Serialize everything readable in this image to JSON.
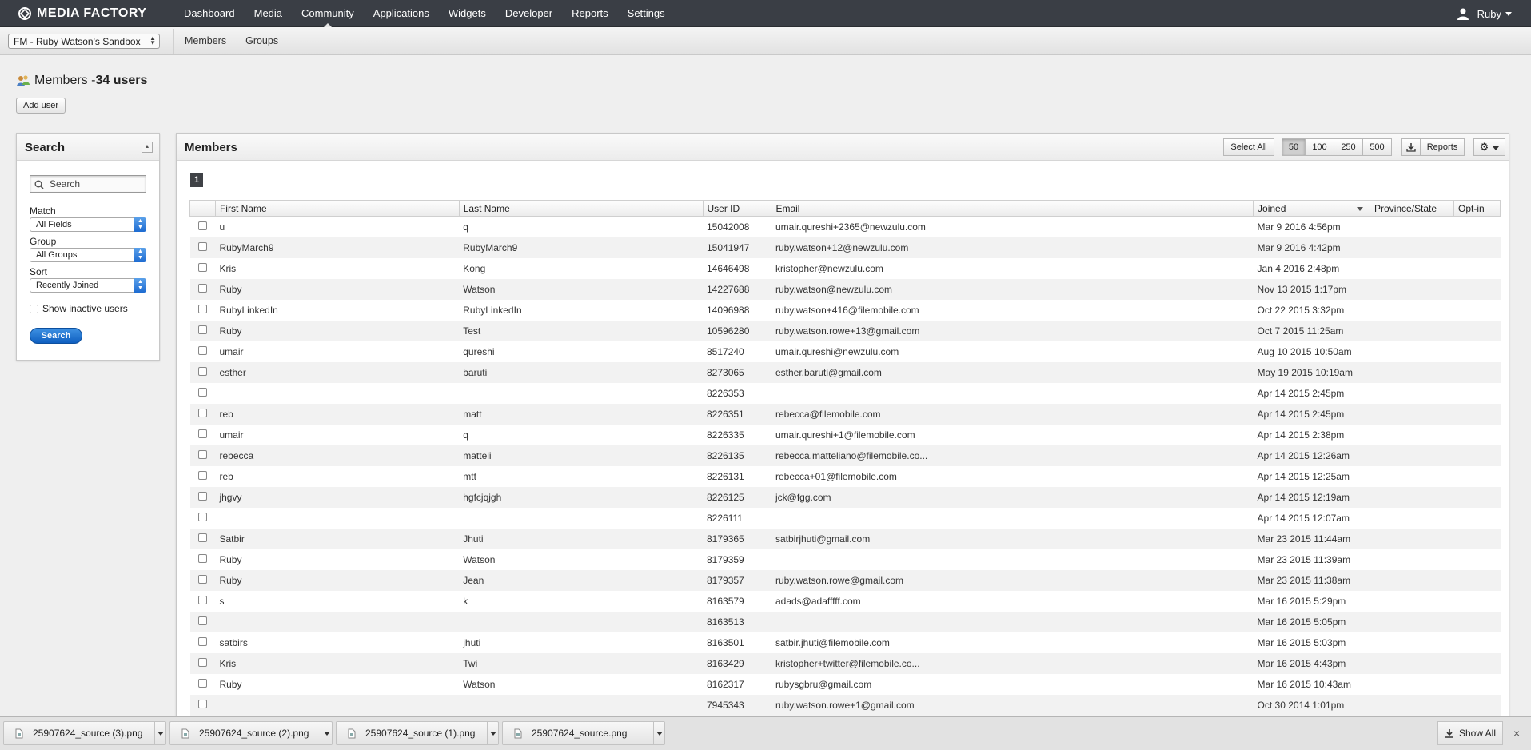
{
  "app": {
    "brand": "MEDIA FACTORY",
    "nav": [
      "Dashboard",
      "Media",
      "Community",
      "Applications",
      "Widgets",
      "Developer",
      "Reports",
      "Settings"
    ],
    "active_nav": "Community",
    "user": "Ruby"
  },
  "subnav": {
    "site": "FM - Ruby Watson's Sandbox",
    "items": [
      "Members",
      "Groups"
    ]
  },
  "header": {
    "title": "Members - ",
    "count": "34 users",
    "add_user": "Add user"
  },
  "search": {
    "title": "Search",
    "placeholder": "Search",
    "match_label": "Match",
    "match_value": "All Fields",
    "group_label": "Group",
    "group_value": "All Groups",
    "sort_label": "Sort",
    "sort_value": "Recently Joined",
    "inactive_label": "Show inactive users",
    "button": "Search"
  },
  "members": {
    "title": "Members",
    "select_all": "Select All",
    "page_sizes": [
      "50",
      "100",
      "250",
      "500"
    ],
    "active_page_size": "50",
    "reports": "Reports",
    "page": "1",
    "columns": [
      "First Name",
      "Last Name",
      "User ID",
      "Email",
      "Joined",
      "Province/State",
      "Opt-in"
    ],
    "sorted_column": "Joined",
    "rows": [
      [
        "u",
        "q",
        "15042008",
        "umair.qureshi+2365@newzulu.com",
        "Mar 9 2016 4:56pm"
      ],
      [
        "RubyMarch9",
        "RubyMarch9",
        "15041947",
        "ruby.watson+12@newzulu.com",
        "Mar 9 2016 4:42pm"
      ],
      [
        "Kris",
        "Kong",
        "14646498",
        "kristopher@newzulu.com",
        "Jan 4 2016 2:48pm"
      ],
      [
        "Ruby",
        "Watson",
        "14227688",
        "ruby.watson@newzulu.com",
        "Nov 13 2015 1:17pm"
      ],
      [
        "RubyLinkedIn",
        "RubyLinkedIn",
        "14096988",
        "ruby.watson+416@filemobile.com",
        "Oct 22 2015 3:32pm"
      ],
      [
        "Ruby",
        "Test",
        "10596280",
        "ruby.watson.rowe+13@gmail.com",
        "Oct 7 2015 11:25am"
      ],
      [
        "umair",
        "qureshi",
        "8517240",
        "umair.qureshi@newzulu.com",
        "Aug 10 2015 10:50am"
      ],
      [
        "esther",
        "baruti",
        "8273065",
        "esther.baruti@gmail.com",
        "May 19 2015 10:19am"
      ],
      [
        "",
        "",
        "8226353",
        "",
        "Apr 14 2015 2:45pm"
      ],
      [
        "reb",
        "matt",
        "8226351",
        "rebecca@filemobile.com",
        "Apr 14 2015 2:45pm"
      ],
      [
        "umair",
        "q",
        "8226335",
        "umair.qureshi+1@filemobile.com",
        "Apr 14 2015 2:38pm"
      ],
      [
        "rebecca",
        "matteli",
        "8226135",
        "rebecca.matteliano@filemobile.co...",
        "Apr 14 2015 12:26am"
      ],
      [
        "reb",
        "mtt",
        "8226131",
        "rebecca+01@filemobile.com",
        "Apr 14 2015 12:25am"
      ],
      [
        "jhgvy",
        "hgfcjqjgh",
        "8226125",
        "jck@fgg.com",
        "Apr 14 2015 12:19am"
      ],
      [
        "",
        "",
        "8226111",
        "",
        "Apr 14 2015 12:07am"
      ],
      [
        "Satbir",
        "Jhuti",
        "8179365",
        "satbirjhuti@gmail.com",
        "Mar 23 2015 11:44am"
      ],
      [
        "Ruby",
        "Watson",
        "8179359",
        "",
        "Mar 23 2015 11:39am"
      ],
      [
        "Ruby",
        "Jean",
        "8179357",
        "ruby.watson.rowe@gmail.com",
        "Mar 23 2015 11:38am"
      ],
      [
        "s",
        "k",
        "8163579",
        "adads@adafffff.com",
        "Mar 16 2015 5:29pm"
      ],
      [
        "",
        "",
        "8163513",
        "",
        "Mar 16 2015 5:05pm"
      ],
      [
        "satbirs",
        "jhuti",
        "8163501",
        "satbir.jhuti@filemobile.com",
        "Mar 16 2015 5:03pm"
      ],
      [
        "Kris",
        "Twi",
        "8163429",
        "kristopher+twitter@filemobile.co...",
        "Mar 16 2015 4:43pm"
      ],
      [
        "Ruby",
        "Watson",
        "8162317",
        "rubysgbru@gmail.com",
        "Mar 16 2015 10:43am"
      ],
      [
        "",
        "",
        "7945343",
        "ruby.watson.rowe+1@gmail.com",
        "Oct 30 2014 1:01pm"
      ]
    ]
  },
  "downloads": {
    "files": [
      "25907624_source (3).png",
      "25907624_source (2).png",
      "25907624_source (1).png",
      "25907624_source.png"
    ],
    "show_all": "Show All",
    "close": "×"
  }
}
